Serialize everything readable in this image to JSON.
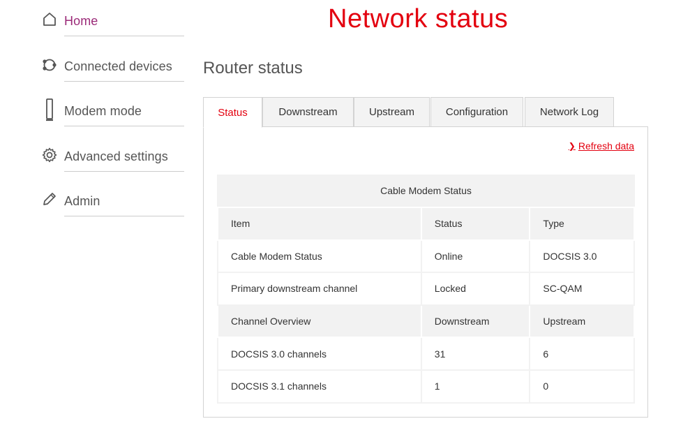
{
  "header": {
    "title": "Network status"
  },
  "sidebar": {
    "items": [
      {
        "label": "Home",
        "icon": "home-icon",
        "active": true
      },
      {
        "label": "Connected devices",
        "icon": "devices-icon"
      },
      {
        "label": "Modem mode",
        "icon": "modem-icon"
      },
      {
        "label": "Advanced settings",
        "icon": "gear-icon"
      },
      {
        "label": "Admin",
        "icon": "pencil-icon"
      }
    ]
  },
  "main": {
    "section_title": "Router status",
    "tabs": [
      {
        "label": "Status",
        "active": true
      },
      {
        "label": "Downstream"
      },
      {
        "label": "Upstream"
      },
      {
        "label": "Configuration"
      },
      {
        "label": "Network Log"
      }
    ],
    "refresh_label": "Refresh data",
    "table": {
      "title": "Cable Modem Status",
      "rows": [
        {
          "cells": [
            "Item",
            "Status",
            "Type"
          ],
          "shaded": true
        },
        {
          "cells": [
            "Cable Modem Status",
            "Online",
            "DOCSIS 3.0"
          ],
          "shaded": false
        },
        {
          "cells": [
            "Primary downstream channel",
            "Locked",
            "SC-QAM"
          ],
          "shaded": false
        },
        {
          "cells": [
            "Channel Overview",
            "Downstream",
            "Upstream"
          ],
          "shaded": true
        },
        {
          "cells": [
            "DOCSIS 3.0 channels",
            "31",
            "6"
          ],
          "shaded": false
        },
        {
          "cells": [
            "DOCSIS 3.1 channels",
            "1",
            "0"
          ],
          "shaded": false
        }
      ]
    }
  },
  "colors": {
    "accent": "#e3000f",
    "active_nav": "#9b2a78",
    "header_bg": "#f2f2f2"
  }
}
